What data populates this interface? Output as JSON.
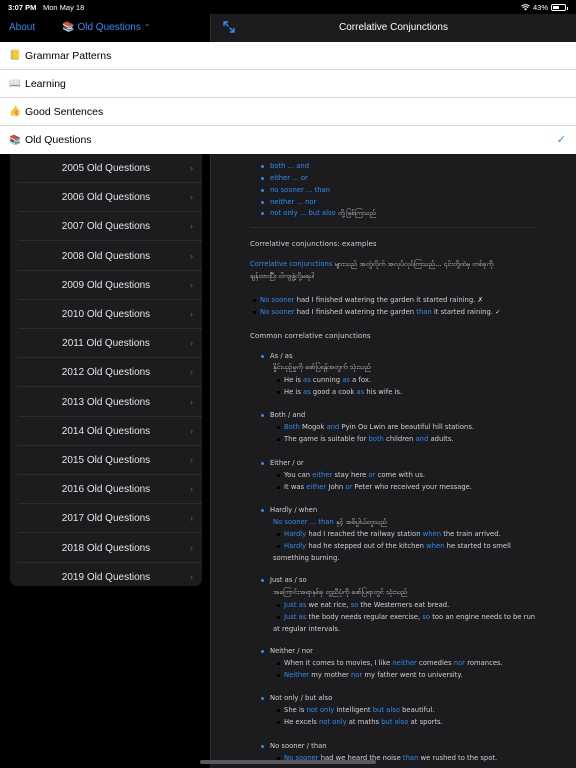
{
  "status": {
    "time": "3:07 PM",
    "date": "Mon May 18",
    "battery": "43%",
    "battery_level": 0.43
  },
  "left_nav": {
    "about": "About",
    "menu_emoji": "📚",
    "menu_label": "Old Questions"
  },
  "right_nav": {
    "title": "Correlative Conjunctions"
  },
  "dropdown": {
    "items": [
      {
        "emoji": "📒",
        "label": "Grammar Patterns"
      },
      {
        "emoji": "📖",
        "label": "Learning"
      },
      {
        "emoji": "👍",
        "label": "Good Sentences"
      },
      {
        "emoji": "📚",
        "label": "Old Questions"
      }
    ],
    "check": "✓"
  },
  "list": {
    "items": [
      "2005 Old Questions",
      "2006 Old Questions",
      "2007 Old Questions",
      "2008 Old Questions",
      "2009 Old Questions",
      "2010 Old Questions",
      "2011 Old Questions",
      "2012 Old Questions",
      "2013 Old Questions",
      "2014 Old Questions",
      "2015 Old Questions",
      "2016 Old Questions",
      "2017 Old Questions",
      "2018 Old Questions",
      "2019 Old Questions"
    ]
  },
  "content": {
    "top_bullets": [
      "both ... and",
      "either ... or",
      "no sooner ... than",
      "neither ... nor"
    ],
    "last_bullet_blue": "not only ... but also",
    "last_bullet_rest": " တို့ဖြစ်ကြသည်",
    "examples_title": "Correlative conjunctions: examples",
    "ex_para_blue": "Correlative conjunctions",
    "ex_para_rest1": " များသည် အတွဲလိုက် အလုပ်လုပ်ကြသည်... ၎င်းတို့ထဲမှ တစ်ခုကို",
    "ex_para_rest2": "ချန်ထားပြီး ဝါကျဖွဲ့လို့မရပါ",
    "ex1": {
      "b": "No sooner",
      "t1": " had I finished watering the garden it started raining. ✗"
    },
    "ex2": {
      "b": "No sooner",
      "t1": " had I finished watering the garden ",
      "b2": "than",
      "t2": " it started raining. ✓"
    },
    "common_title": "Common correlative conjunctions",
    "as_head": "As / as",
    "as_desc": "နှိုင်းယှဉ်မှုကို ဖော်ပြရန်အတွက် သုံးသည်",
    "as_ex1": {
      "t1": "He is ",
      "b1": "as",
      "t2": " cunning ",
      "b2": "as",
      "t3": " a fox."
    },
    "as_ex2": {
      "t1": "He is ",
      "b1": "as",
      "t2": " good a cook ",
      "b2": "as",
      "t3": " his wife is."
    },
    "both_head": "Both / and",
    "both_ex1": {
      "b1": "Both",
      "t1": " Mogok ",
      "b2": "and",
      "t2": " Pyin Oo Lwin are beautiful hill stations."
    },
    "both_ex2": {
      "t1": "The game is suitable for ",
      "b1": "both",
      "t2": " children ",
      "b2": "and",
      "t3": " adults."
    },
    "either_head": "Either / or",
    "either_ex1": {
      "t1": "You can ",
      "b1": "either",
      "t2": " stay here ",
      "b2": "or",
      "t3": " come with us."
    },
    "either_ex2": {
      "t1": "It was ",
      "b1": "either",
      "t2": " John ",
      "b2": "or",
      "t3": " Peter who received your message."
    },
    "hardly_head": "Hardly / when",
    "hardly_desc_blue": "No sooner ... than",
    "hardly_desc_rest": " နှင့် အဓိပ္ပါယ်တူသည်",
    "hardly_ex1": {
      "b1": "Hardly",
      "t1": " had I reached the railway station ",
      "b2": "when",
      "t2": " the train arrived."
    },
    "hardly_ex2": {
      "b1": "Hardly",
      "t1": " had he stepped out of the kitchen ",
      "b2": "when",
      "t2": " he started to smell"
    },
    "hardly_ex2_cont": "something burning.",
    "justas_head": "Just as / so",
    "justas_desc": "အကြောင်းအရာနှစ်ခု တူညီပုံကို ဖော်ပြရာတွင် သုံးသည်",
    "justas_ex1": {
      "b1": "Just as",
      "t1": " we eat rice, ",
      "b2": "so",
      "t2": " the Westerners eat bread."
    },
    "justas_ex2": {
      "b1": "Just as",
      "t1": " the body needs regular exercise, ",
      "b2": "so",
      "t2": " too an engine needs to be run"
    },
    "justas_ex2_cont": "at regular intervals.",
    "neither_head": "Neither / nor",
    "neither_ex1": {
      "t1": "When it comes to movies, I like ",
      "b1": "neither",
      "t2": " comedies ",
      "b2": "nor",
      "t3": " romances."
    },
    "neither_ex2": {
      "b1": "Neither",
      "t1": " my mother ",
      "b2": "nor",
      "t2": " my father went to university."
    },
    "notonly_head": "Not only / but also",
    "notonly_ex1": {
      "t1": "She is ",
      "b1": "not only",
      "t2": " intelligent ",
      "b2": "but also",
      "t3": " beautiful."
    },
    "notonly_ex2": {
      "t1": "He excels ",
      "b1": "not only",
      "t2": " at maths ",
      "b2": "but also",
      "t3": " at sports."
    },
    "nosooner_head": "No sooner / than",
    "nosooner_ex1": {
      "b1": "No sooner",
      "t1": " had we heard the noise ",
      "b2": "than",
      "t2": " we rushed to the spot."
    }
  }
}
